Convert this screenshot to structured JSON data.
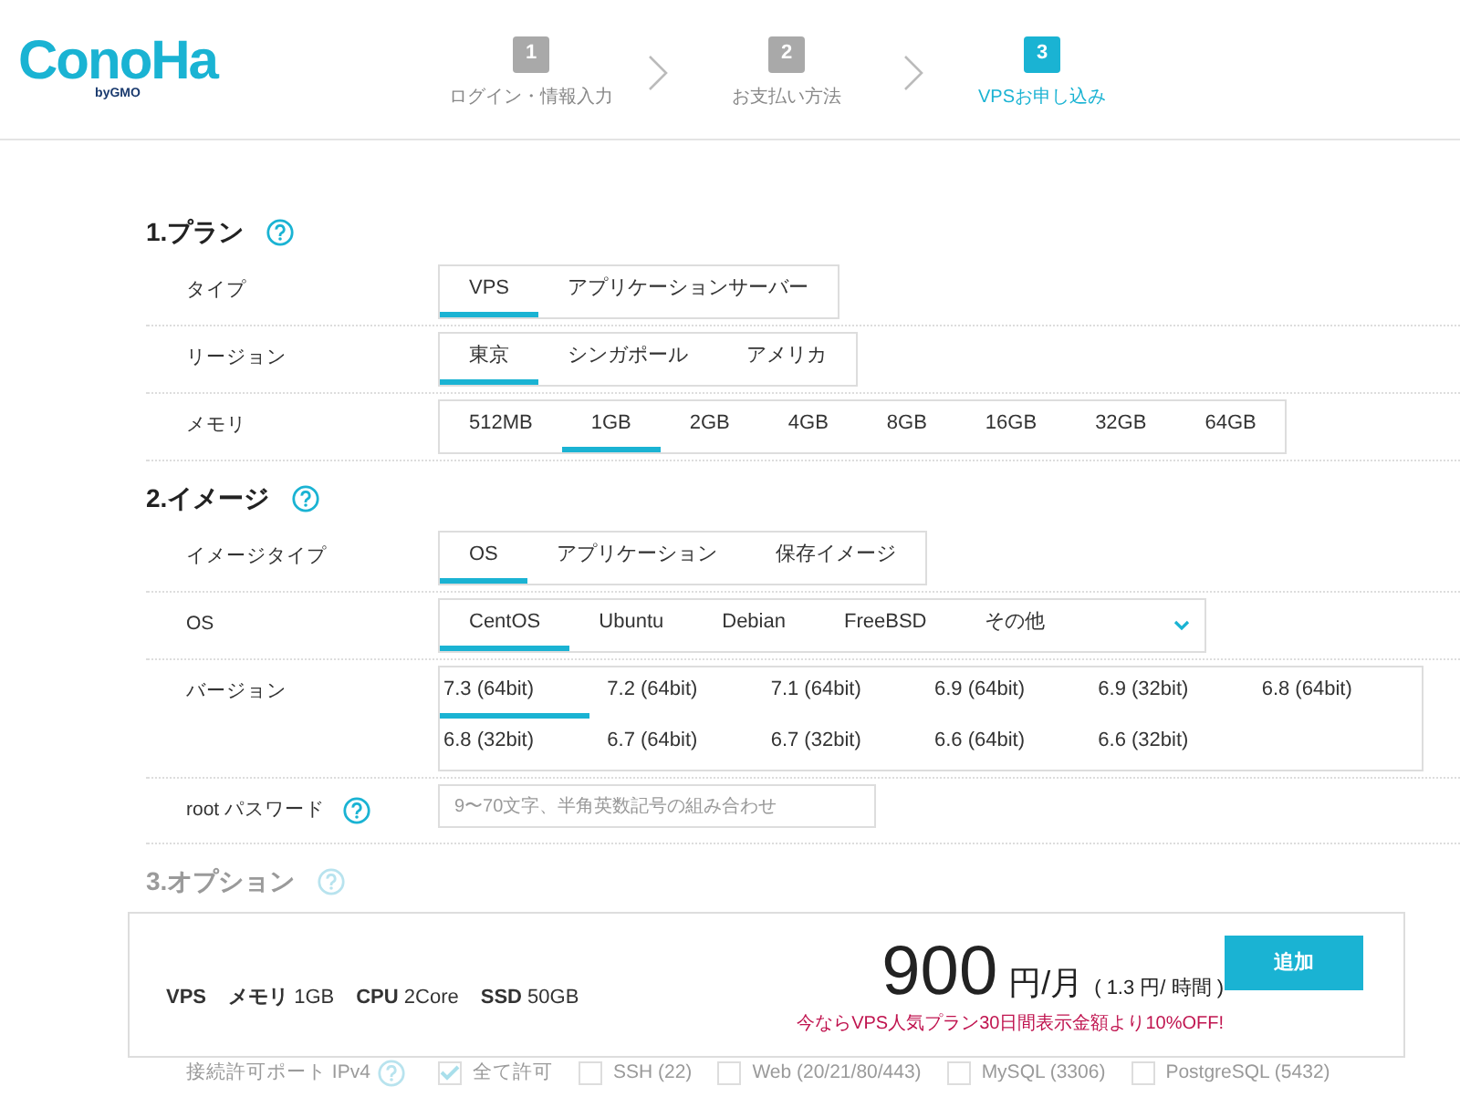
{
  "logo": {
    "name": "ConoHa",
    "byline": "byGMO"
  },
  "steps": [
    {
      "number": "1",
      "label": "ログイン・情報入力",
      "selected": false
    },
    {
      "number": "2",
      "label": "お支払い方法",
      "selected": false
    },
    {
      "number": "3",
      "label": "VPSお申し込み",
      "selected": true
    }
  ],
  "sections": [
    {
      "title": "1.プラン",
      "help": true,
      "disabled": false,
      "rows": [
        {
          "kind": "options",
          "label": "タイプ",
          "options": [
            {
              "label": "VPS",
              "selected": true
            },
            {
              "label": "アプリケーションサーバー",
              "selected": false
            }
          ]
        },
        {
          "kind": "options",
          "label": "リージョン",
          "options": [
            {
              "label": "東京",
              "selected": true
            },
            {
              "label": "シンガポール",
              "selected": false
            },
            {
              "label": "アメリカ",
              "selected": false
            }
          ]
        },
        {
          "kind": "options",
          "label": "メモリ",
          "options": [
            {
              "label": "512MB",
              "selected": false
            },
            {
              "label": "1GB",
              "selected": true
            },
            {
              "label": "2GB",
              "selected": false
            },
            {
              "label": "4GB",
              "selected": false
            },
            {
              "label": "8GB",
              "selected": false
            },
            {
              "label": "16GB",
              "selected": false
            },
            {
              "label": "32GB",
              "selected": false
            },
            {
              "label": "64GB",
              "selected": false
            }
          ]
        }
      ]
    },
    {
      "title": "2.イメージ",
      "help": true,
      "disabled": false,
      "rows": [
        {
          "kind": "options",
          "label": "イメージタイプ",
          "options": [
            {
              "label": "OS",
              "selected": true
            },
            {
              "label": "アプリケーション",
              "selected": false
            },
            {
              "label": "保存イメージ",
              "selected": false
            }
          ]
        },
        {
          "kind": "dropdown",
          "label": "OS",
          "options": [
            {
              "label": "CentOS",
              "selected": true
            },
            {
              "label": "Ubuntu",
              "selected": false
            },
            {
              "label": "Debian",
              "selected": false
            },
            {
              "label": "FreeBSD",
              "selected": false
            },
            {
              "label": "その他",
              "selected": false
            }
          ]
        },
        {
          "kind": "grid",
          "label": "バージョン",
          "options": [
            {
              "label": "7.3 (64bit)",
              "selected": true
            },
            {
              "label": "7.2 (64bit)",
              "selected": false
            },
            {
              "label": "7.1 (64bit)",
              "selected": false
            },
            {
              "label": "6.9 (64bit)",
              "selected": false
            },
            {
              "label": "6.9 (32bit)",
              "selected": false
            },
            {
              "label": "6.8 (64bit)",
              "selected": false
            },
            {
              "label": "6.8 (32bit)",
              "selected": false
            },
            {
              "label": "6.7 (64bit)",
              "selected": false
            },
            {
              "label": "6.7 (32bit)",
              "selected": false
            },
            {
              "label": "6.6 (64bit)",
              "selected": false
            },
            {
              "label": "6.6 (32bit)",
              "selected": false
            }
          ]
        },
        {
          "kind": "input",
          "label": "root パスワード",
          "help": true,
          "placeholder": "9〜70文字、半角英数記号の組み合わせ"
        }
      ]
    },
    {
      "title": "3.オプション",
      "help": true,
      "disabled": true
    }
  ],
  "summary": {
    "specs": [
      {
        "name": "VPS"
      },
      {
        "name": "メモリ",
        "value": "1GB"
      },
      {
        "name": "CPU",
        "value": "2Core"
      },
      {
        "name": "SSD",
        "value": "50GB"
      }
    ],
    "price": "900",
    "unit": "円/月",
    "hourly": "( 1.3 円/ 時間 )",
    "promo": "今ならVPS人気プラン30日間表示金額より10%OFF!",
    "button": "追加"
  },
  "ports": {
    "label": "接続許可ポート IPv4",
    "help": true,
    "items": [
      {
        "label": "全て許可",
        "checked": true
      },
      {
        "label": "SSH (22)",
        "checked": false
      },
      {
        "label": "Web (20/21/80/443)",
        "checked": false
      },
      {
        "label": "MySQL (3306)",
        "checked": false
      },
      {
        "label": "PostgreSQL (5432)",
        "checked": false
      }
    ]
  }
}
